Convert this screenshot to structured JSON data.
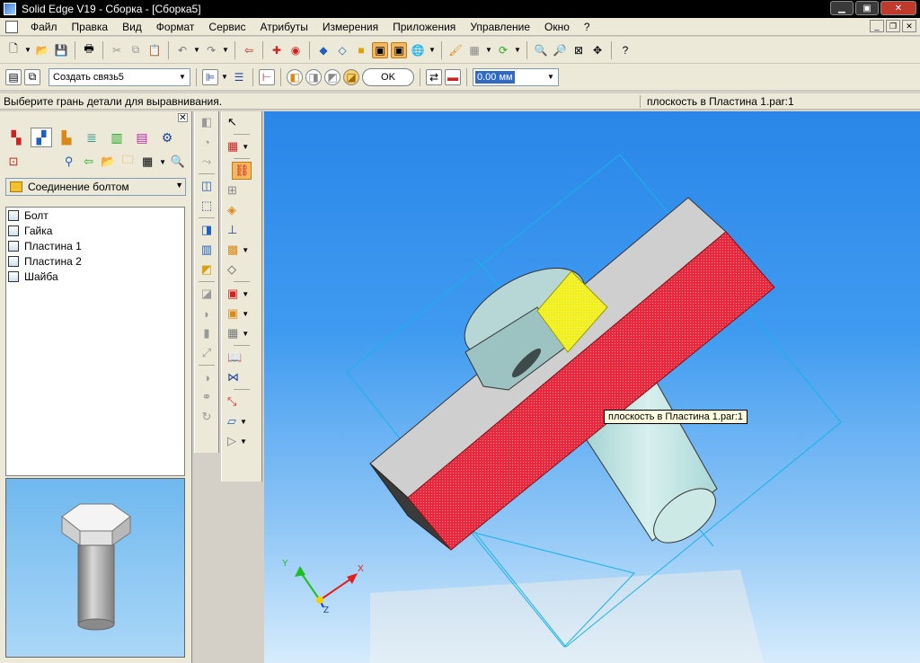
{
  "window": {
    "title": "Solid Edge V19 - Сборка - [Сборка5]"
  },
  "menu": [
    {
      "label": "Файл",
      "u": 0
    },
    {
      "label": "Правка",
      "u": 0
    },
    {
      "label": "Вид",
      "u": 0
    },
    {
      "label": "Формат",
      "u": 0
    },
    {
      "label": "Сервис",
      "u": 0
    },
    {
      "label": "Атрибуты",
      "u": 0
    },
    {
      "label": "Измерения",
      "u": 0
    },
    {
      "label": "Приложения",
      "u": 0
    },
    {
      "label": "Управление",
      "u": 0
    },
    {
      "label": "Окно",
      "u": 0
    },
    {
      "label": "?",
      "u": 0
    }
  ],
  "relationship_bar": {
    "combo_value": "Создать связь5",
    "ok_label": "OK",
    "offset_value": "0.00 мм"
  },
  "status": {
    "prompt": "Выберите грань детали для выравнивания.",
    "hover_info": "плоскость в Пластина 1.par:1"
  },
  "pathfinder": {
    "assembly_name": "Соединение болтом",
    "items": [
      "Болт",
      "Гайка",
      "Пластина 1",
      "Пластина 2",
      "Шайба"
    ]
  },
  "viewport": {
    "tooltip": "плоскость в Пластина 1.par:1",
    "axes": {
      "x": "X",
      "y": "Y",
      "z": "Z"
    }
  }
}
